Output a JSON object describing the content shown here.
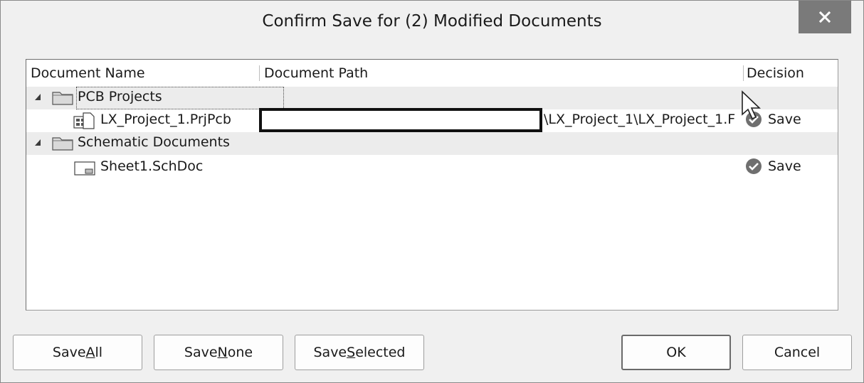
{
  "dialog": {
    "title": "Confirm Save for (2) Modified Documents",
    "close_icon": "close-icon"
  },
  "columns": {
    "name": "Document Name",
    "path": "Document Path",
    "decision": "Decision"
  },
  "groups": [
    {
      "label": "PCB Projects",
      "items": [
        {
          "name": "LX_Project_1.PrjPcb",
          "path_visible": "\\LX_Project_1\\LX_Project_1.F",
          "decision": "Save"
        }
      ]
    },
    {
      "label": "Schematic Documents",
      "items": [
        {
          "name": "Sheet1.SchDoc",
          "path_visible": "",
          "decision": "Save"
        }
      ]
    }
  ],
  "buttons": {
    "save_all": {
      "pre": "Save ",
      "mnemonic": "A",
      "post": "ll"
    },
    "save_none": {
      "pre": "Save ",
      "mnemonic": "N",
      "post": "one"
    },
    "save_selected": {
      "pre": "Save ",
      "mnemonic": "S",
      "post": "elected"
    },
    "ok": "OK",
    "cancel": "Cancel"
  }
}
